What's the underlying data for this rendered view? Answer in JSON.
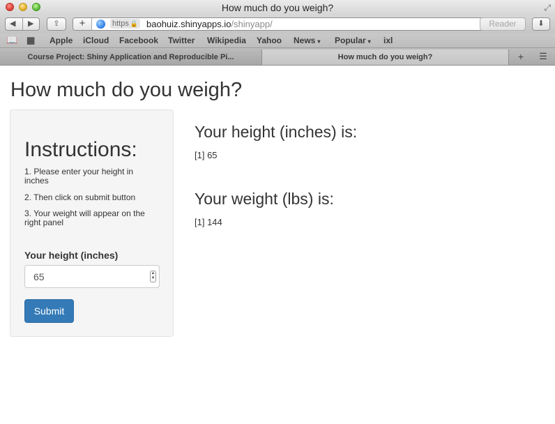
{
  "window": {
    "title": "How much do you weigh?"
  },
  "toolbar": {
    "back_icon": "◀",
    "forward_icon": "▶",
    "share_icon": "⇪",
    "add_icon": "+",
    "https_label": "https",
    "url_domain": "baohuiz.shinyapps.io",
    "url_path": "/shinyapp/",
    "reload_icon": "↻",
    "reader_label": "Reader",
    "download_icon": "⬇"
  },
  "bookmarks": {
    "items": [
      "Apple",
      "iCloud",
      "Facebook",
      "Twitter",
      "Wikipedia",
      "Yahoo",
      "News",
      "Popular",
      "ixl"
    ],
    "caret": "▾"
  },
  "tabs": {
    "items": [
      {
        "label": "Course Project: Shiny Application and Reproducible Pi..."
      },
      {
        "label": "How much do you weigh?"
      }
    ],
    "new_tab_icon": "+",
    "tab_view_icon": "☰"
  },
  "app": {
    "title": "How much do you weigh?",
    "sidebar": {
      "heading": "Instructions:",
      "steps": [
        "1. Please enter your height in inches",
        "2. Then click on submit button",
        "3. Your weight will appear on the right panel"
      ],
      "input_label": "Your height (inches)",
      "input_value": "65",
      "submit_label": "Submit"
    },
    "main": {
      "height_heading": "Your height (inches) is:",
      "height_output": "[1] 65",
      "weight_heading": "Your weight (lbs) is:",
      "weight_output": "[1] 144"
    }
  },
  "colors": {
    "submit_bg": "#337ab7",
    "sidebar_bg": "#f5f5f5"
  }
}
